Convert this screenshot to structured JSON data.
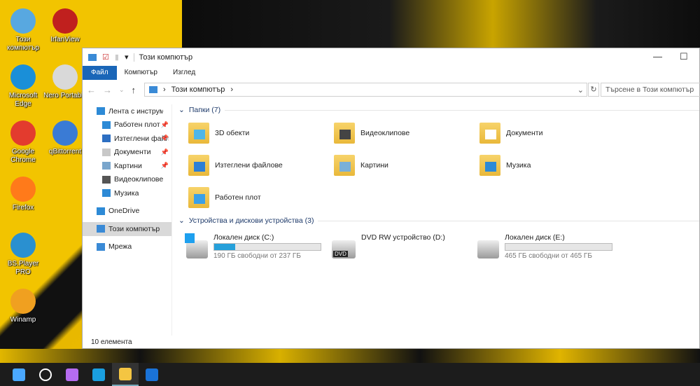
{
  "desktop": {
    "icons": [
      {
        "label": "Този компютър",
        "color": "#58a8e0"
      },
      {
        "label": "IrfanView",
        "color": "#c0201e"
      },
      {
        "label": "Microsoft Edge",
        "color": "#1a8fd8"
      },
      {
        "label": "Nero Portable",
        "color": "#d9d9d9"
      },
      {
        "label": "Google Chrome",
        "color": "#e33b2e"
      },
      {
        "label": "qBittorrent",
        "color": "#3a7bd5"
      },
      {
        "label": "Firefox",
        "color": "#ff7a1a"
      },
      {
        "label": "BS.Player PRO",
        "color": "#2a90d0"
      },
      {
        "label": "Winamp",
        "color": "#f0a020"
      }
    ]
  },
  "window": {
    "title": "Този компютър",
    "ribbon": {
      "file": "Файл",
      "computer": "Компютър",
      "view": "Изглед"
    },
    "address": {
      "path": "Този компютър",
      "search_placeholder": "Търсене в Този компютър"
    },
    "sidebar": [
      {
        "label": "Лента с инструменти",
        "icon": "star-icon",
        "color": "#2d8ad6"
      },
      {
        "label": "Работен плот",
        "icon": "desktop-icon",
        "pinned": true,
        "color": "#2d8ad6"
      },
      {
        "label": "Изтеглени файлове",
        "icon": "download-icon",
        "pinned": true,
        "color": "#2d6fc2"
      },
      {
        "label": "Документи",
        "icon": "document-icon",
        "pinned": true,
        "color": "#c8c8c8"
      },
      {
        "label": "Картини",
        "icon": "pictures-icon",
        "pinned": true,
        "color": "#7aa6cc"
      },
      {
        "label": "Видеоклипове",
        "icon": "video-icon",
        "color": "#555"
      },
      {
        "label": "Музика",
        "icon": "music-icon",
        "color": "#2d8ad6"
      },
      {
        "label": "OneDrive",
        "icon": "cloud-icon",
        "color": "#2d8ad6"
      },
      {
        "label": "Този компютър",
        "icon": "computer-icon",
        "selected": true,
        "color": "#3a8ad6"
      },
      {
        "label": "Мрежа",
        "icon": "network-icon",
        "color": "#3a8ad6"
      }
    ],
    "folders_header": "Папки (7)",
    "folders": [
      {
        "label": "3D обекти",
        "color": "#4fb6e8"
      },
      {
        "label": "Видеоклипове",
        "color": "#444"
      },
      {
        "label": "Документи",
        "color": "#fff"
      },
      {
        "label": "Изтеглени файлове",
        "color": "#2d7fd6"
      },
      {
        "label": "Картини",
        "color": "#7ab0d8"
      },
      {
        "label": "Музика",
        "color": "#2d8ad6"
      },
      {
        "label": "Работен плот",
        "color": "#3aa0e8"
      }
    ],
    "drives_header": "Устройства и дискови устройства (3)",
    "drives": [
      {
        "label": "Локален диск (C:)",
        "free": "190 ГБ свободни от 237 ГБ",
        "used_percent": 19.8,
        "has_bar": true
      },
      {
        "label": "DVD RW устройство (D:)",
        "badge": "DVD",
        "has_bar": false
      },
      {
        "label": "Локален диск (E:)",
        "free": "465 ГБ свободни от 465 ГБ",
        "used_percent": 0,
        "has_bar": true
      }
    ],
    "status": "10 елемента"
  },
  "taskbar": [
    "start-icon",
    "search-icon",
    "copilot-icon",
    "edge-icon",
    "file-explorer-icon",
    "outlook-icon"
  ]
}
